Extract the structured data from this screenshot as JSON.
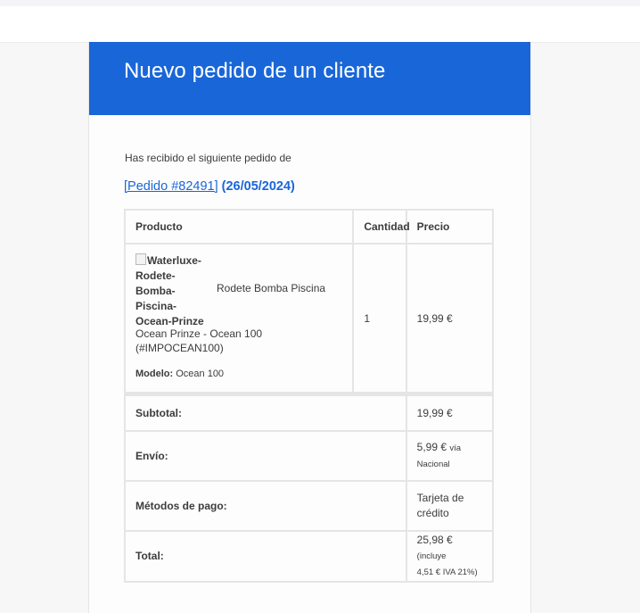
{
  "header": {
    "title": "Nuevo pedido de un cliente"
  },
  "intro": "Has recibido el siguiente pedido de",
  "order": {
    "link_text": "[Pedido #82491]",
    "date": "(26/05/2024)"
  },
  "table": {
    "headers": [
      "Producto",
      "Cantidad",
      "Precio"
    ],
    "item": {
      "image_alt": "Waterluxe-Rodete-Bomba-Piscina-Ocean-Prinze",
      "image_alt_lines": [
        "Waterluxe-",
        "Rodete-",
        "Bomba-",
        "Piscina-",
        "Ocean-Prinze"
      ],
      "name": "Rodete Bomba Piscina",
      "variant": "Ocean Prinze - Ocean 100 (#IMPOCEAN100)",
      "model_label": "Modelo:",
      "model_value": "Ocean 100",
      "quantity": "1",
      "price": "19,99 €"
    },
    "totals": {
      "subtotal_label": "Subtotal:",
      "subtotal_value": "19,99 €",
      "shipping_label": "Envío:",
      "shipping_value": "5,99 €",
      "shipping_via": "vía",
      "shipping_method": "Nacional",
      "payment_label": "Métodos de pago:",
      "payment_value": "Tarjeta de crédito",
      "total_label": "Total:",
      "total_value": "25,98 €",
      "total_note_1": "(incluye",
      "total_note_2": "4,51 € IVA 21%)"
    }
  }
}
